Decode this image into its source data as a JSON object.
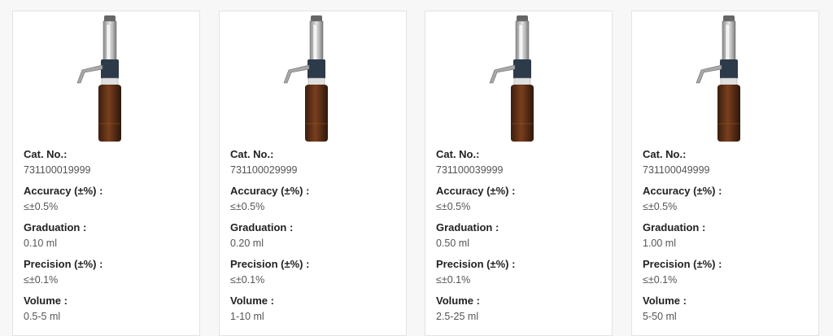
{
  "products": [
    {
      "image": "bottle-top-dispenser",
      "specs": [
        {
          "label": "Cat. No.:",
          "value": "731100019999"
        },
        {
          "label": "Accuracy (±%) :",
          "value": "≤±0.5%"
        },
        {
          "label": "Graduation :",
          "value": "0.10 ml"
        },
        {
          "label": "Precision (±%) :",
          "value": "≤±0.1%"
        },
        {
          "label": "Volume :",
          "value": "0.5-5 ml"
        }
      ]
    },
    {
      "image": "bottle-top-dispenser",
      "specs": [
        {
          "label": "Cat. No.:",
          "value": "731100029999"
        },
        {
          "label": "Accuracy (±%) :",
          "value": "≤±0.5%"
        },
        {
          "label": "Graduation :",
          "value": "0.20 ml"
        },
        {
          "label": "Precision (±%) :",
          "value": "≤±0.1%"
        },
        {
          "label": "Volume :",
          "value": "1-10 ml"
        }
      ]
    },
    {
      "image": "bottle-top-dispenser",
      "specs": [
        {
          "label": "Cat. No.:",
          "value": "731100039999"
        },
        {
          "label": "Accuracy (±%) :",
          "value": "≤±0.5%"
        },
        {
          "label": "Graduation :",
          "value": "0.50 ml"
        },
        {
          "label": "Precision (±%) :",
          "value": "≤±0.1%"
        },
        {
          "label": "Volume :",
          "value": "2.5-25 ml"
        }
      ]
    },
    {
      "image": "bottle-top-dispenser",
      "specs": [
        {
          "label": "Cat. No.:",
          "value": "731100049999"
        },
        {
          "label": "Accuracy (±%) :",
          "value": "≤±0.5%"
        },
        {
          "label": "Graduation :",
          "value": "1.00 ml"
        },
        {
          "label": "Precision (±%) :",
          "value": "≤±0.1%"
        },
        {
          "label": "Volume :",
          "value": "5-50 ml"
        }
      ]
    }
  ]
}
